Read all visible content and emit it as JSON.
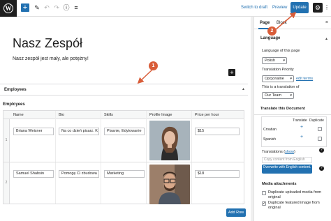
{
  "toolbar": {
    "logo_glyph": "W",
    "add_glyph": "+",
    "edit_glyph": "✎",
    "undo_glyph": "↶",
    "redo_glyph": "↷",
    "info_glyph": "ⓘ",
    "list_glyph": "≡",
    "switch_to_draft": "Switch to draft",
    "preview": "Preview",
    "update": "Update",
    "settings_glyph": "⚙",
    "more_glyph": "⋮"
  },
  "post": {
    "title": "Nasz Zespół",
    "paragraph": "Nasz zespół jest mały, ale potężny!",
    "inserter_glyph": "+"
  },
  "employees_block": {
    "panel_title": "Employees",
    "caret": "▴",
    "section_label": "Employees",
    "columns": [
      "Name",
      "Bio",
      "Skills",
      "Profile Image",
      "Price per hour"
    ],
    "rows": [
      {
        "num": "1",
        "name": "Briana Weisner",
        "bio": "Na co dzień pisarz. K",
        "skills": "Pisanie, Edytowanie",
        "price": "$15"
      },
      {
        "num": "2",
        "name": "Samuel Shabsin",
        "bio": "Pomogę Ci zbudowa",
        "skills": "Marketing",
        "price": "$18"
      }
    ],
    "add_row": "Add Row"
  },
  "sidebar": {
    "tabs": [
      "Page",
      "Block"
    ],
    "close_glyph": "×",
    "language_section": {
      "heading": "Language",
      "caret": "▴",
      "language_of_page_label": "Language of this page",
      "language_value": "Polish",
      "translation_priority_label": "Translation Priority",
      "priority_value": "Opcjonalne",
      "edit_terms": "edit terms",
      "translation_of_label": "This is a translation of",
      "translation_of_value": "Our Team"
    },
    "translate_section": {
      "heading": "Translate this Document",
      "col_translate": "Translate",
      "col_duplicate": "Duplicate",
      "languages": [
        "Croatian",
        "Spanish"
      ],
      "plus_glyph": "+"
    },
    "translations": {
      "label": "Translations",
      "show_link": "show",
      "copy_placeholder": "Copy content from English",
      "overwrite_button": "Overwrite with English content.",
      "help_glyph": "?"
    },
    "media": {
      "heading": "Media attachments",
      "dup_uploaded": "Duplicate uploaded media from original",
      "dup_featured": "Duplicate featured image from original"
    }
  },
  "annotations": {
    "callout_1": "1",
    "callout_2": "2",
    "arrow_color": "#d95d39"
  },
  "colors": {
    "accent": "#2271b1",
    "annotation": "#d95d39"
  }
}
